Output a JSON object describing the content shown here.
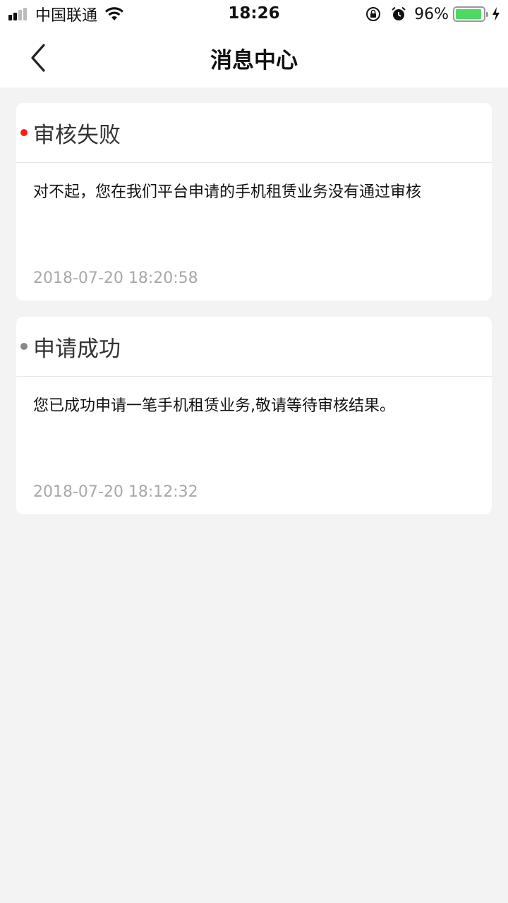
{
  "status_bar": {
    "carrier": "中国联通",
    "time": "18:26",
    "battery": "96%",
    "battery_level": 0.96,
    "icons": [
      "signal-icon",
      "wifi-icon",
      "rotation-lock-icon",
      "alarm-icon",
      "battery-icon",
      "charging-icon"
    ]
  },
  "nav": {
    "title": "消息中心",
    "back_icon": "chevron-left-icon"
  },
  "messages": [
    {
      "title": "审核失败",
      "body": "对不起，您在我们平台申请的手机租赁业务没有通过审核",
      "time": "2018-07-20 18:20:58",
      "dot_color": "#ff1a1a"
    },
    {
      "title": "申请成功",
      "body": "您已成功申请一笔手机租赁业务,敬请等待审核结果。",
      "time": "2018-07-20 18:12:32",
      "dot_color": "#888888"
    }
  ],
  "colors": {
    "background": "#f3f3f3",
    "card": "#ffffff",
    "timestamp": "#a8a8a8",
    "battery_fill": "#4cd964"
  }
}
